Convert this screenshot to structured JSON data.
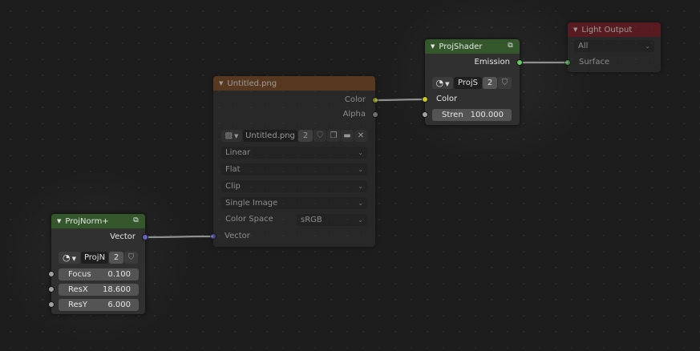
{
  "colors": {
    "shader_header": "#34582c",
    "texture_header": "#7c4b23",
    "output_header": "#7b1a23",
    "socket_color": "#c7c729",
    "socket_shader": "#63c763",
    "socket_vector": "#6363c7",
    "socket_float": "#a1a1a1",
    "link": "#8f8f8f"
  },
  "nodes": {
    "proj_norm": {
      "title": "ProjNorm+",
      "output_vector": "Vector",
      "datablock": {
        "icon": "node-tree-icon",
        "name": "ProjN",
        "users": "2"
      },
      "inputs": [
        {
          "label": "Focus",
          "value": "0.100"
        },
        {
          "label": "ResX",
          "value": "18.600"
        },
        {
          "label": "ResY",
          "value": "6.000"
        }
      ]
    },
    "image_texture": {
      "title": "Untitled.png",
      "output_color": "Color",
      "output_alpha": "Alpha",
      "image": {
        "icon": "image-icon",
        "name": "Untitled.png",
        "users": "2"
      },
      "interpolation": "Linear",
      "projection": "Flat",
      "extension": "Clip",
      "source": "Single Image",
      "color_space_label": "Color Space",
      "color_space": "sRGB",
      "input_vector": "Vector"
    },
    "proj_shader": {
      "title": "ProjShader",
      "output_emission": "Emission",
      "datablock": {
        "icon": "node-tree-icon",
        "name": "ProjS",
        "users": "2"
      },
      "input_color": "Color",
      "strength": {
        "label": "Stren",
        "value": "100.000"
      }
    },
    "light_output": {
      "title": "Light Output",
      "target": "All",
      "input_surface": "Surface"
    }
  }
}
